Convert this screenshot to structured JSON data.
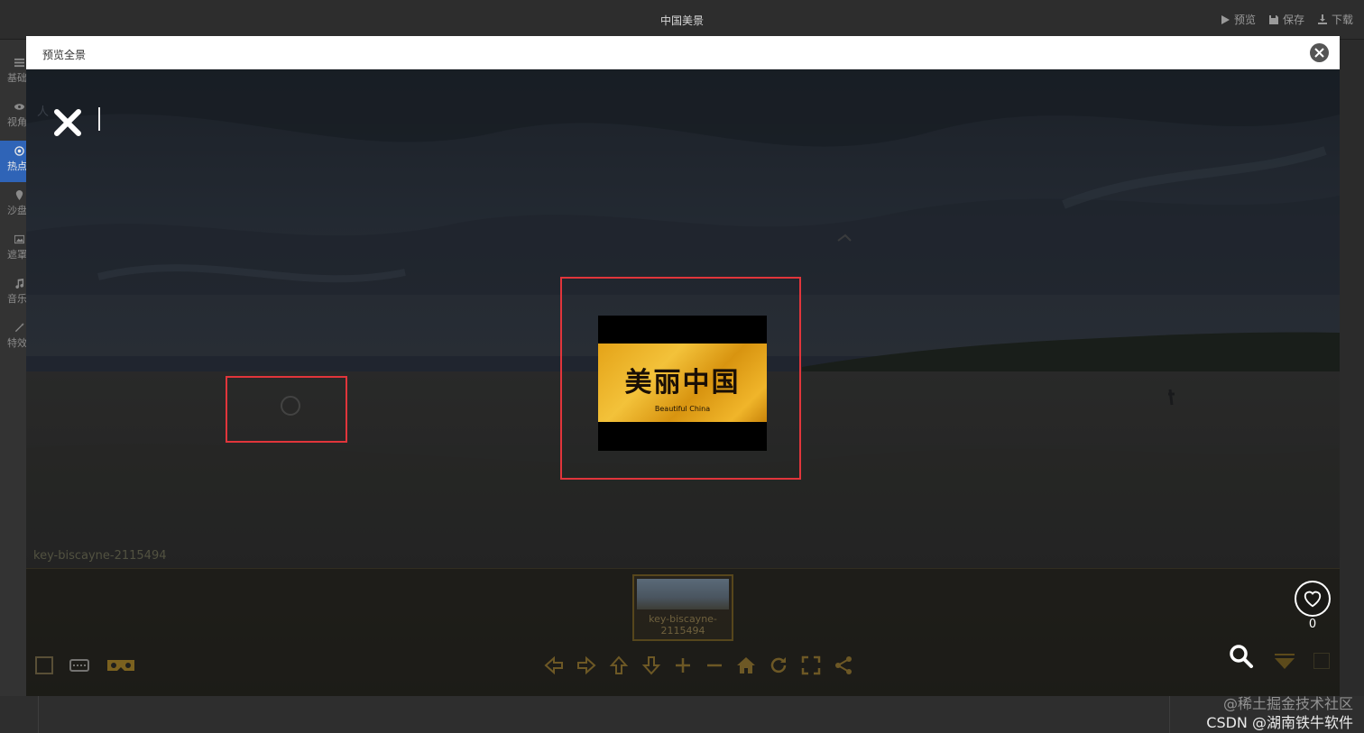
{
  "window": {
    "title": "中国美景",
    "actions": [
      {
        "label": "预览",
        "icon": "play-icon"
      },
      {
        "label": "保存",
        "icon": "save-icon"
      },
      {
        "label": "下载",
        "icon": "download-icon"
      }
    ]
  },
  "sidebar": {
    "items": [
      {
        "label": "基础",
        "icon": "list-icon",
        "active": false
      },
      {
        "label": "视角",
        "icon": "eye-icon",
        "active": false
      },
      {
        "label": "热点",
        "icon": "target-icon",
        "active": true
      },
      {
        "label": "沙盘",
        "icon": "map-pin-icon",
        "active": false
      },
      {
        "label": "遮罩",
        "icon": "image-icon",
        "active": false
      },
      {
        "label": "音乐",
        "icon": "music-icon",
        "active": false
      },
      {
        "label": "特效",
        "icon": "magic-wand-icon",
        "active": false
      }
    ]
  },
  "modal": {
    "title": "预览全景",
    "close_icon": "close-circle-icon"
  },
  "viewer": {
    "scene_name": "key-biscayne-2115494",
    "hotspot_banner": {
      "title": "美丽中国",
      "subtitle": "Beautiful China"
    },
    "thumbnail": {
      "caption": "key-biscayne-\n2115494"
    },
    "controls": [
      "arrow-left-icon",
      "arrow-right-icon",
      "arrow-up-icon",
      "arrow-down-icon",
      "zoom-in-icon",
      "zoom-out-icon",
      "home-icon",
      "refresh-icon",
      "fullscreen-icon",
      "share-icon"
    ],
    "left_controls": [
      "cube-icon",
      "keyboard-icon",
      "vr-goggles-icon"
    ],
    "likes": {
      "count": "0",
      "icon": "heart-icon"
    },
    "search_icon": "search-icon",
    "colors": {
      "hotspot_frame": "#e1353b",
      "banner_gold": "#f3c23a",
      "sidebar_active": "#2f64b7"
    }
  },
  "watermark": {
    "line1": "@稀土掘金技术社区",
    "line2": "CSDN @湖南铁牛软件"
  }
}
